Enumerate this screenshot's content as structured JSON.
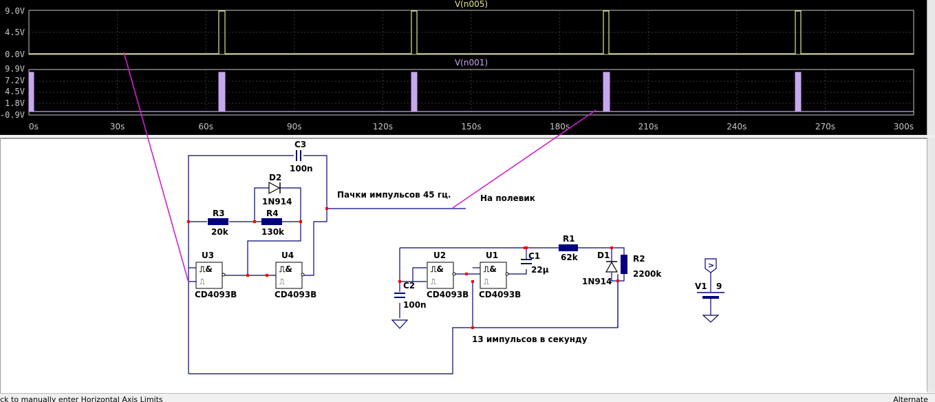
{
  "waveform": {
    "top_trace": {
      "name": "V(n005)",
      "color": "#e6e68a",
      "y_ticks": [
        "9.0V",
        "4.5V",
        "0.0V"
      ]
    },
    "bottom_trace": {
      "name": "V(n001)",
      "color": "#c9a6f0",
      "y_ticks": [
        "9.9V",
        "7.2V",
        "4.5V",
        "1.8V",
        "-0.9V"
      ]
    },
    "x_ticks": [
      "0s",
      "30s",
      "60s",
      "90s",
      "120s",
      "150s",
      "180s",
      "210s",
      "240s",
      "270s",
      "300s"
    ],
    "grid_color": "#3a3a3a",
    "axis_color": "#c8c8c8"
  },
  "schematic": {
    "components": {
      "c3": {
        "ref": "C3",
        "value": "100n"
      },
      "d2": {
        "ref": "D2",
        "value": "1N914"
      },
      "r3": {
        "ref": "R3",
        "value": "20k"
      },
      "r4": {
        "ref": "R4",
        "value": "130k"
      },
      "u3": {
        "ref": "U3",
        "value": "CD4093B"
      },
      "u4": {
        "ref": "U4",
        "value": "CD4093B"
      },
      "u2": {
        "ref": "U2",
        "value": "CD4093B"
      },
      "u1": {
        "ref": "U1",
        "value": "CD4093B"
      },
      "c1": {
        "ref": "C1",
        "value": "22µ"
      },
      "c2": {
        "ref": "C2",
        "value": "100n"
      },
      "r1": {
        "ref": "R1",
        "value": "62k"
      },
      "d1": {
        "ref": "D1",
        "value": "1N914"
      },
      "r2": {
        "ref": "R2",
        "value": "2200k"
      },
      "v1": {
        "ref": "V1",
        "value": "9"
      }
    },
    "gate_symbol": "⎍&",
    "notes": {
      "bursts": "Пачки импульсов  45 гц.",
      "to_fet": "На полевик",
      "per_second": "13 импульсов в секунду"
    },
    "wire_color": "#000080",
    "node_color": "#ff0000",
    "probe_color": "#d020d0"
  },
  "status_bar": {
    "left": "lick to manually enter Horizontal Axis Limits",
    "right": "Alternate"
  }
}
